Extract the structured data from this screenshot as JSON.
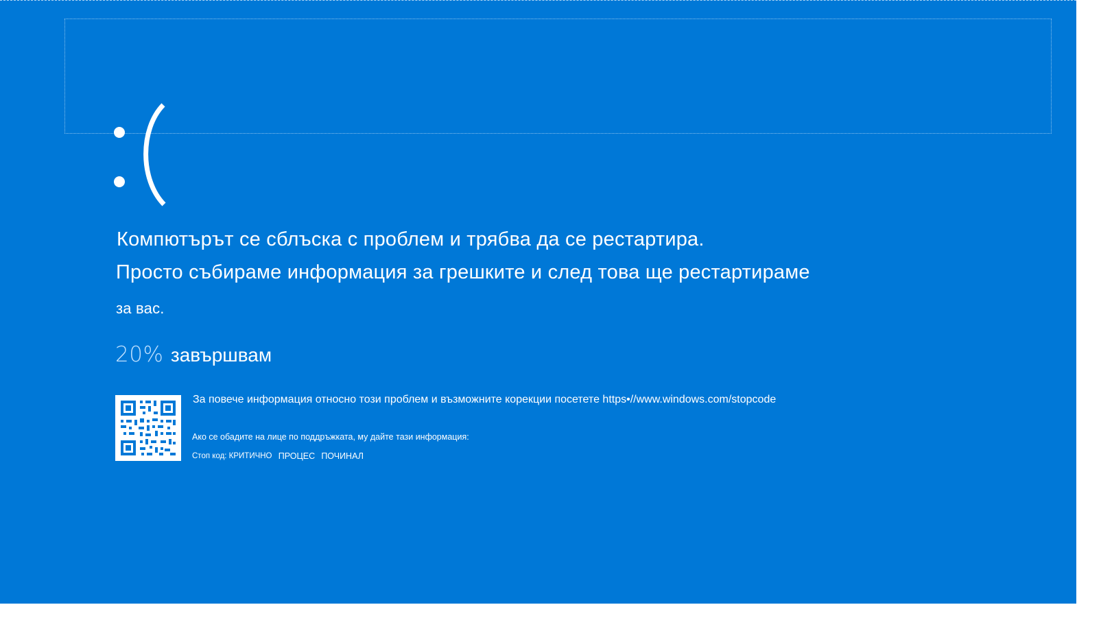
{
  "bsod": {
    "background_color": "#0078d7",
    "face": ":(",
    "message_line1": "Компютърът се сблъска с проблем и трябва да се рестартира.",
    "message_line2": "Просто събираме информация за грешките и след това ще рестартираме",
    "message_line3": "за вас.",
    "progress_percent": "20%",
    "progress_label": "завършвам",
    "progress_value": 20,
    "more_info": "За повече информация относно този проблем и възможните корекции посетете https•//www.windows.com/stopcode",
    "support_note": "Ако се обадите на лице по поддръжката, му дайте тази информация:",
    "stop_code_label": "Стоп код: КРИТИЧНО",
    "stop_code_word2": "ПРОЦЕС",
    "stop_code_word3": "ПОЧИНАЛ",
    "qr_icon": "qr-code-icon"
  }
}
